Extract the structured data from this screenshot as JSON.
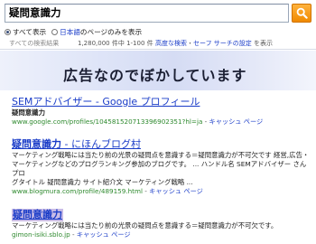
{
  "search": {
    "query": "疑問意識力"
  },
  "radios": {
    "all_label": "すべて表示",
    "japanese_label": "日本語",
    "japanese_suffix": "のページのみを表示"
  },
  "results_bar": {
    "scope_label": "すべての検索結果",
    "count_text": "1,280,000 件中 1-100 件",
    "advanced_label": "高度な検索",
    "separator": "・",
    "safe_label": "セーフ サーチの設定",
    "safe_suffix": " を表示"
  },
  "ad_banner": {
    "text": "広告なのでぼかしています"
  },
  "results": [
    {
      "title": "SEMアドバイザー - Google プロフィール",
      "snippet": "疑問意識力",
      "url": "www.google.com/profiles/10458152071339690235​1?hl=ja",
      "cache_label": "キャッシュ ページ"
    },
    {
      "title_bold": "疑問意識力",
      "title_rest": " - にほんブログ村",
      "snippet_1": "マーケティング戦略には当たり前の光景の疑問点を意識する＝疑問意識力が不可欠です 経営,広告・マーケティングなどのプログランキング参加のブログです。 ... ハンドル名 SEMアドバイザー さん プロ",
      "snippet_2": "グタイトル 疑問意識力 サイト紹介文 マーケティング戦略 ...",
      "url": "www.blogmura.com/profile/489159.html",
      "cache_label": "キャッシュ ページ"
    },
    {
      "title": "疑問意識力",
      "snippet": "マーケティング戦略には当たり前の光景の疑問点を意識する＝疑問意識力が不可欠です。",
      "url": "gimon-isiki.sblo.jp",
      "cache_label": "キャッシュ ページ"
    }
  ],
  "colors": {
    "link": "#1a3cc8",
    "url_green": "#2f8a2f",
    "search_button": "#f08a00",
    "visited_highlight": "#c9bce6"
  }
}
